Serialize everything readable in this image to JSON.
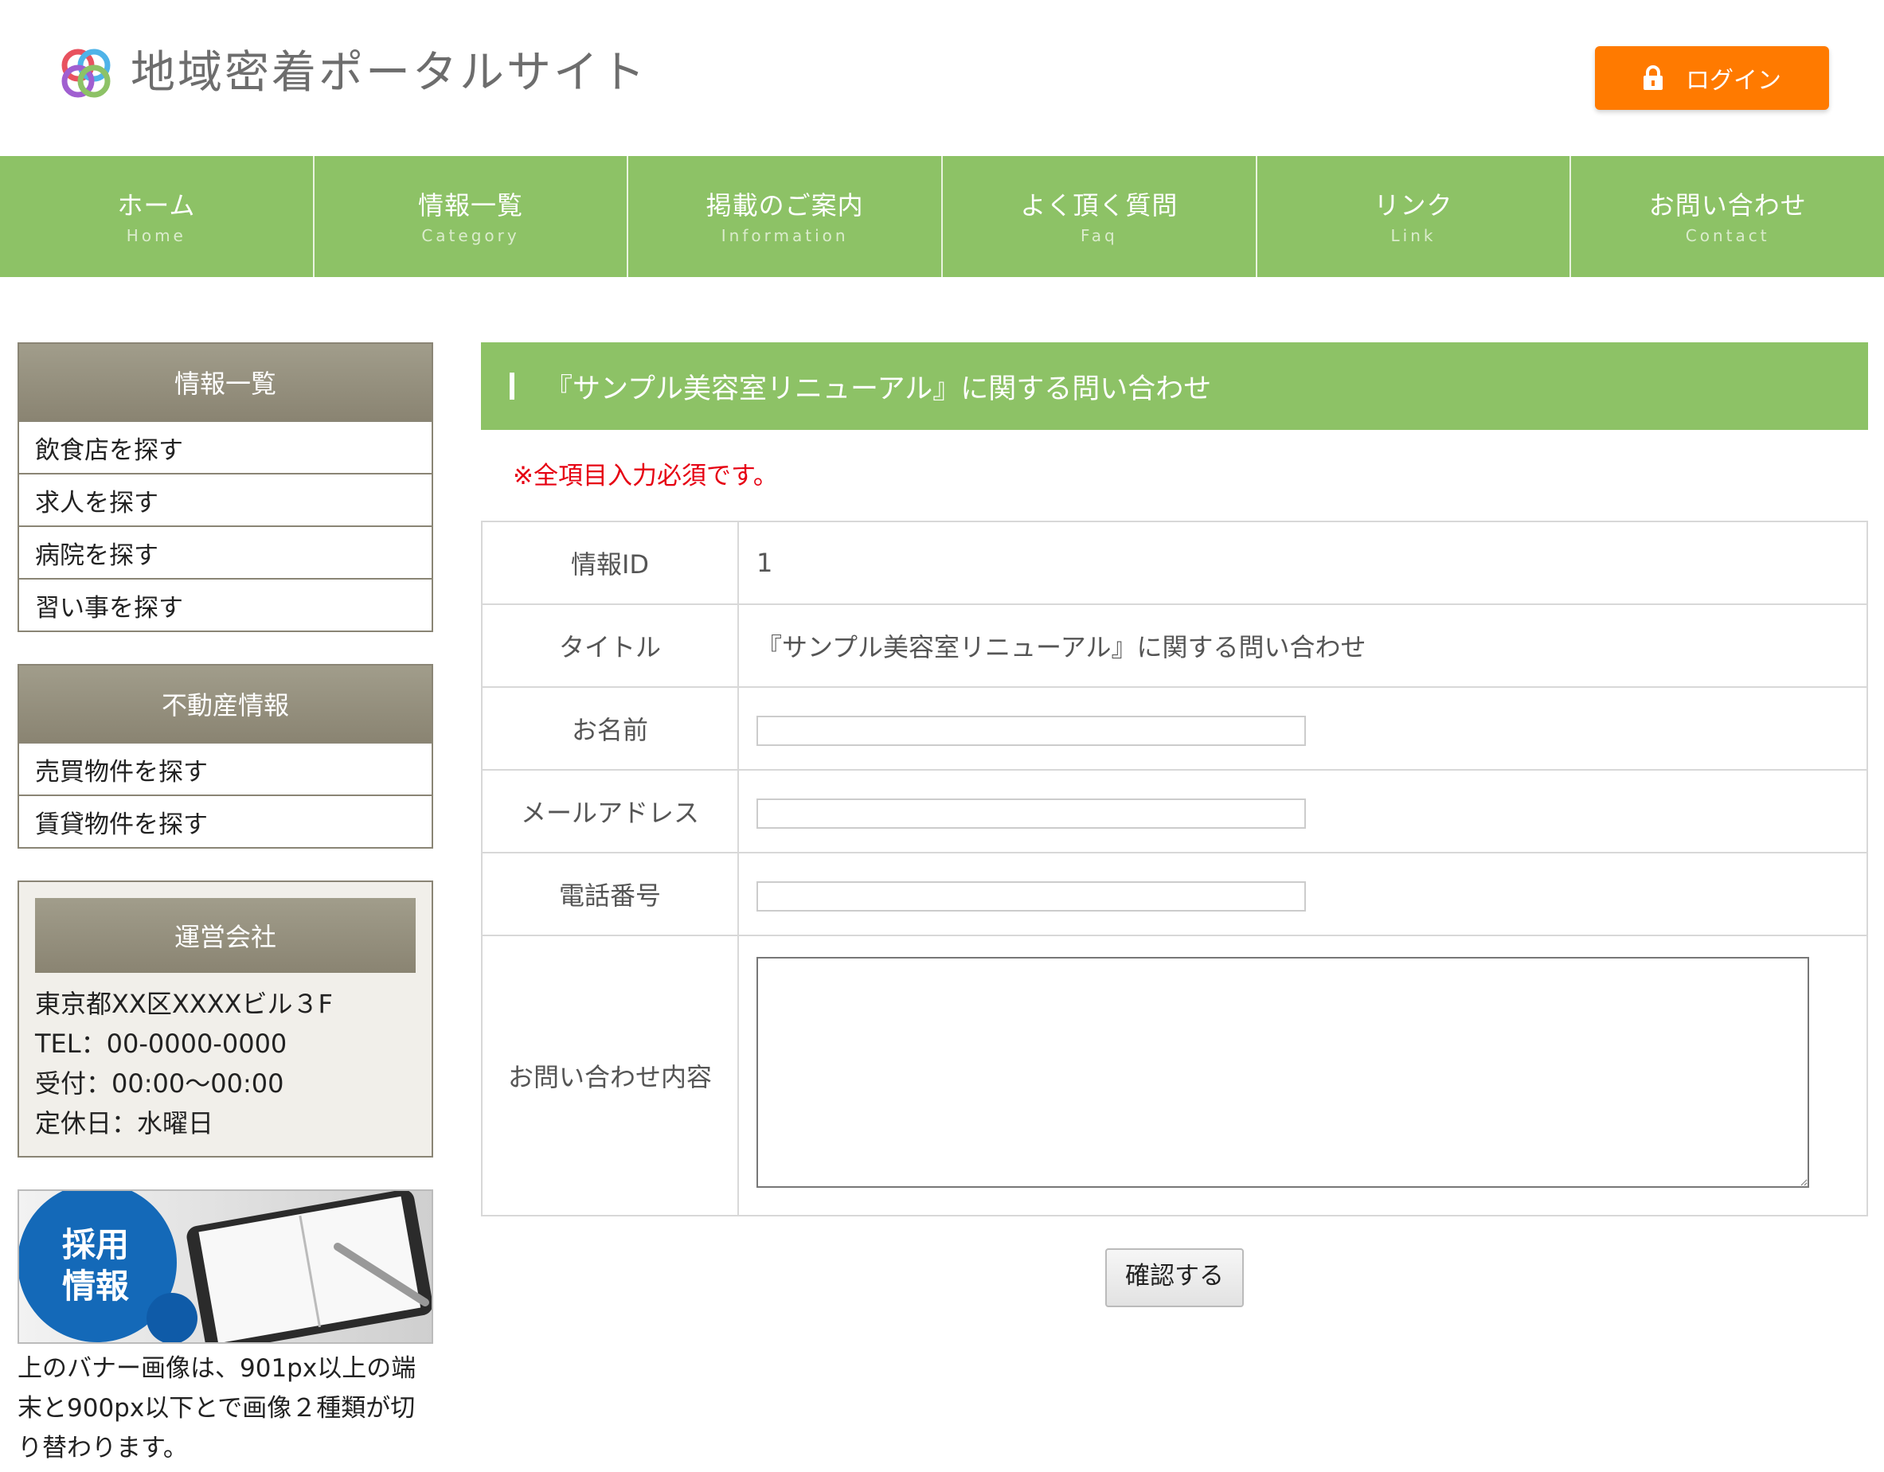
{
  "header": {
    "site_title": "地域密着ポータルサイト",
    "login_label": "ログイン"
  },
  "nav": [
    {
      "jp": "ホーム",
      "en": "Home"
    },
    {
      "jp": "情報一覧",
      "en": "Category"
    },
    {
      "jp": "掲載のご案内",
      "en": "Information"
    },
    {
      "jp": "よく頂く質問",
      "en": "Faq"
    },
    {
      "jp": "リンク",
      "en": "Link"
    },
    {
      "jp": "お問い合わせ",
      "en": "Contact"
    }
  ],
  "sidebar": {
    "info": {
      "title": "情報一覧",
      "items": [
        "飲食店を探す",
        "求人を探す",
        "病院を探す",
        "習い事を探す"
      ]
    },
    "realestate": {
      "title": "不動産情報",
      "items": [
        "売買物件を探す",
        "賃貸物件を探す"
      ]
    },
    "company": {
      "title": "運営会社",
      "lines": [
        "東京都XX区XXXXビル３F",
        "TEL：00-0000-0000",
        "受付：00:00〜00:00",
        "定休日：水曜日"
      ]
    },
    "banner": {
      "text_line1": "採用",
      "text_line2": "情報",
      "note": "上のバナー画像は、901px以上の端末と900px以下とで画像２種類が切り替わります。"
    }
  },
  "main": {
    "heading": "『サンプル美容室リニューアル』に関する問い合わせ",
    "required_note": "※全項目入力必須です。",
    "form": {
      "info_id_label": "情報ID",
      "info_id_value": "1",
      "title_label": "タイトル",
      "title_value": "『サンプル美容室リニューアル』に関する問い合わせ",
      "name_label": "お名前",
      "name_value": "",
      "email_label": "メールアドレス",
      "email_value": "",
      "phone_label": "電話番号",
      "phone_value": "",
      "message_label": "お問い合わせ内容",
      "message_value": ""
    },
    "confirm_label": "確認する"
  },
  "colors": {
    "nav_green": "#8dc266",
    "login_orange": "#ff7a00",
    "sidebar_title": "#8a8472",
    "required_red": "#e60012"
  }
}
